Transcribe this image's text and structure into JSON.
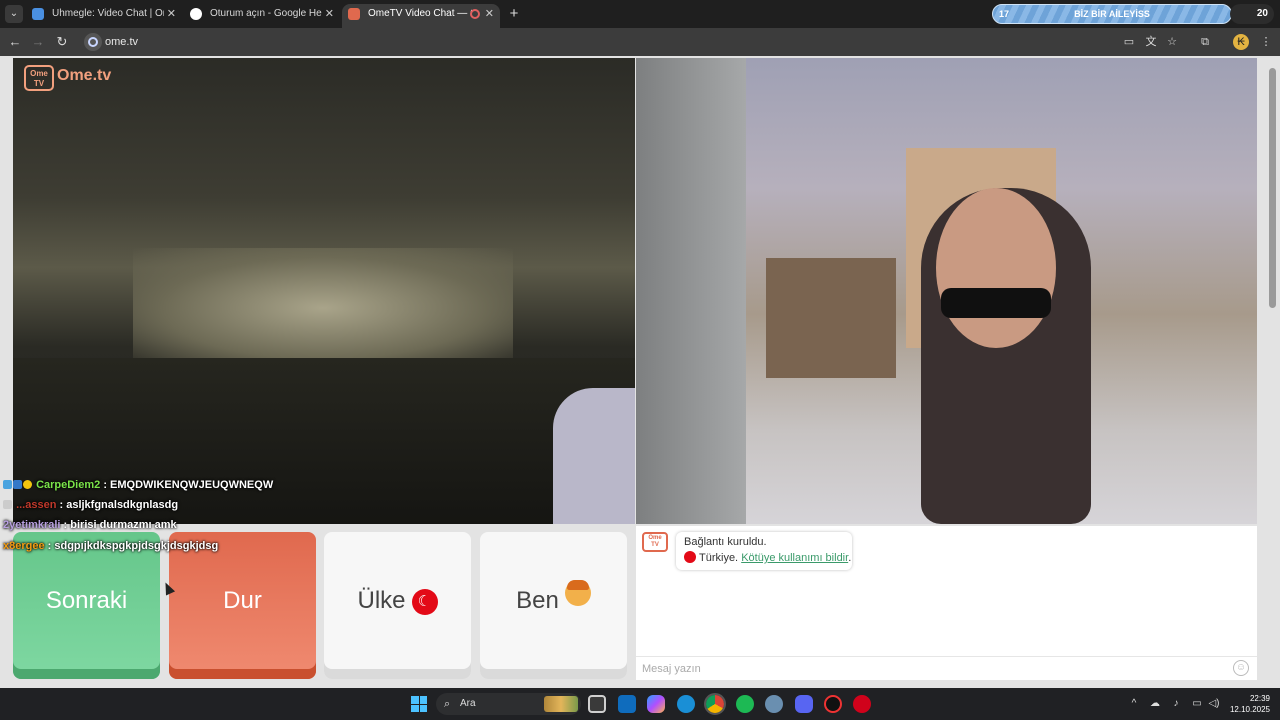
{
  "browser": {
    "tabs": [
      {
        "title": "Uhmegle: Video Chat | Omegle",
        "active": false,
        "favicon_color": "#4a90e2"
      },
      {
        "title": "Oturum açın - Google Hesapları",
        "active": false,
        "favicon_color": "#ffffff"
      },
      {
        "title": "OmeTV Video Chat — Omegle",
        "active": true,
        "favicon_color": "#e0694e"
      }
    ],
    "new_tab_symbol": "+",
    "banner": {
      "left_number": "17",
      "text": "BİZ BİR AİLEYİSS"
    },
    "badge_number": "20",
    "url": "ome.tv"
  },
  "site": {
    "logo_badge": "Ome TV",
    "logo_text": "Ome.tv",
    "overlay_messages": [
      {
        "name": "CarpeDiem2",
        "name_color": "#7be34a",
        "text": ": EMQDWIKENQWJEUQWNEQW"
      },
      {
        "name": "...assen",
        "name_color": "#c0392b",
        "text": ": asljkfgnalsdkgnlasdg"
      },
      {
        "name": "2yetimkrali",
        "name_color": "#b8a0e0",
        "text": ": birisi durmazmı amk"
      },
      {
        "name": "x8ergee",
        "name_color": "#f39c12",
        "text": ": sdgpıjkdkspgkpjdsgkjdsgkjdsg"
      }
    ],
    "buttons": {
      "next": "Sonraki",
      "stop": "Dur",
      "country": "Ülke",
      "me": "Ben"
    },
    "chat": {
      "avatar_text": "Ome TV",
      "connected": "Bağlantı kuruldu.",
      "country_name": "Türkiye.",
      "report_link": "Kötüye kullanımı bildir",
      "report_suffix": ".",
      "input_placeholder": "Mesaj yazın"
    }
  },
  "taskbar": {
    "search_placeholder": "Ara",
    "time": "22:39",
    "date": "12.10.2025"
  },
  "colors": {
    "next_button": "#65c68a",
    "stop_button": "#e0694e",
    "brand": "#f2a07e",
    "turkey_flag": "#e30a17"
  }
}
